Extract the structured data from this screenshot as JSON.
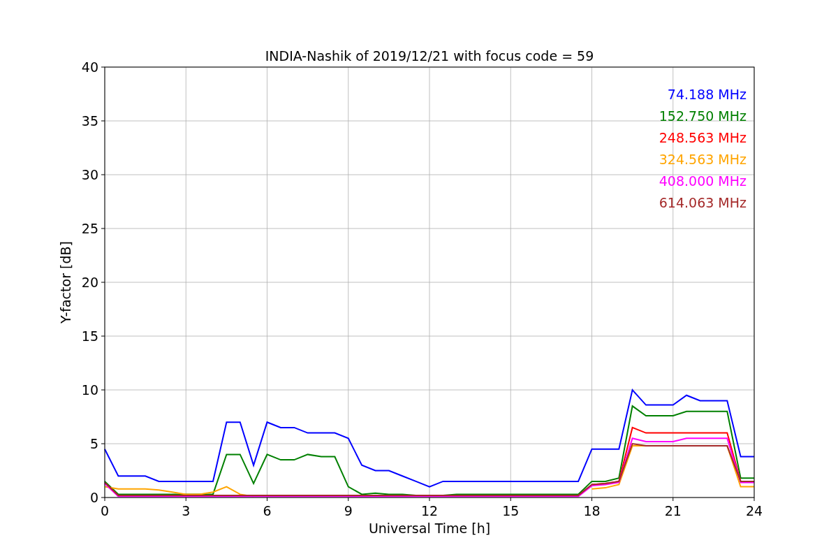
{
  "chart_data": {
    "type": "line",
    "title": "INDIA-Nashik of 2019/12/21 with focus code = 59",
    "xlabel": "Universal Time [h]",
    "ylabel": "Y-factor [dB]",
    "xlim": [
      0,
      24
    ],
    "ylim": [
      0,
      40
    ],
    "xticks": [
      0,
      3,
      6,
      9,
      12,
      15,
      18,
      21,
      24
    ],
    "yticks": [
      0,
      5,
      10,
      15,
      20,
      25,
      30,
      35,
      40
    ],
    "grid": true,
    "x": [
      0,
      0.5,
      1,
      1.5,
      2,
      2.5,
      3,
      3.5,
      4,
      4.5,
      5,
      5.5,
      6,
      6.5,
      7,
      7.5,
      8,
      8.5,
      9,
      9.5,
      10,
      10.5,
      11,
      11.5,
      12,
      12.5,
      13,
      13.5,
      14,
      14.5,
      15,
      15.5,
      16,
      16.5,
      17,
      17.5,
      18,
      18.5,
      19,
      19.5,
      20,
      20.5,
      21,
      21.5,
      22,
      22.5,
      23,
      23.5,
      24
    ],
    "series": [
      {
        "name": "74.188 MHz",
        "color": "#0000ff",
        "values": [
          4.5,
          2,
          2,
          2,
          1.5,
          1.5,
          1.5,
          1.5,
          1.5,
          7,
          7,
          3,
          7,
          6.5,
          6.5,
          6,
          6,
          6,
          5.5,
          3,
          2.5,
          2.5,
          2,
          1.5,
          1,
          1.5,
          1.5,
          1.5,
          1.5,
          1.5,
          1.5,
          1.5,
          1.5,
          1.5,
          1.5,
          1.5,
          4.5,
          4.5,
          4.5,
          10,
          8.6,
          8.6,
          8.6,
          9.5,
          9,
          9,
          9,
          3.8,
          3.8
        ]
      },
      {
        "name": "152.750 MHz",
        "color": "#008000",
        "values": [
          1.5,
          0.3,
          0.3,
          0.3,
          0.3,
          0.3,
          0.3,
          0.3,
          0.3,
          4,
          4,
          1.3,
          4,
          3.5,
          3.5,
          4,
          3.8,
          3.8,
          1,
          0.3,
          0.4,
          0.3,
          0.3,
          0.2,
          0.2,
          0.2,
          0.3,
          0.3,
          0.3,
          0.3,
          0.3,
          0.3,
          0.3,
          0.3,
          0.3,
          0.3,
          1.5,
          1.5,
          1.8,
          8.5,
          7.6,
          7.6,
          7.6,
          8,
          8,
          8,
          8,
          1.8,
          1.8
        ]
      },
      {
        "name": "248.563 MHz",
        "color": "#ff0000",
        "values": [
          null,
          null,
          null,
          null,
          null,
          null,
          null,
          null,
          null,
          null,
          null,
          null,
          null,
          null,
          null,
          null,
          null,
          null,
          null,
          null,
          null,
          null,
          null,
          null,
          null,
          null,
          null,
          null,
          null,
          null,
          null,
          null,
          null,
          null,
          null,
          null,
          1.2,
          1.3,
          1.5,
          6.5,
          6,
          6,
          6,
          6,
          6,
          6,
          6,
          1.5,
          1.5
        ]
      },
      {
        "name": "324.563 MHz",
        "color": "#ffa500",
        "values": [
          1,
          0.8,
          0.8,
          0.8,
          0.7,
          0.5,
          0.3,
          0.3,
          0.5,
          1,
          0.3,
          0.1,
          null,
          null,
          null,
          null,
          null,
          null,
          null,
          null,
          null,
          null,
          null,
          null,
          null,
          null,
          null,
          null,
          null,
          null,
          null,
          null,
          null,
          null,
          null,
          null,
          0.8,
          0.9,
          1.2,
          4.8,
          4.8,
          4.8,
          4.8,
          4.8,
          4.8,
          4.8,
          4.8,
          1,
          1
        ]
      },
      {
        "name": "408.000 MHz",
        "color": "#ff00ff",
        "values": [
          1.3,
          0.1,
          0.1,
          0.1,
          0.1,
          0.1,
          0.1,
          0.1,
          0.1,
          0.1,
          0.1,
          0.1,
          0.1,
          0.1,
          0.1,
          0.1,
          0.1,
          0.1,
          0.1,
          0.1,
          0.1,
          0.1,
          0.1,
          0.1,
          0.1,
          0.1,
          0.1,
          0.1,
          0.1,
          0.1,
          0.1,
          0.1,
          0.1,
          0.1,
          0.1,
          0.1,
          1.1,
          1.2,
          1.4,
          5.5,
          5.2,
          5.2,
          5.2,
          5.5,
          5.5,
          5.5,
          5.5,
          1.4,
          1.4
        ]
      },
      {
        "name": "614.063 MHz",
        "color": "#a52a2a",
        "values": [
          1.4,
          0.2,
          0.2,
          0.2,
          0.2,
          0.2,
          0.2,
          0.2,
          0.2,
          0.2,
          0.2,
          0.2,
          0.2,
          0.2,
          0.2,
          0.2,
          0.2,
          0.2,
          0.2,
          0.2,
          0.2,
          0.2,
          0.2,
          0.2,
          0.2,
          0.2,
          0.2,
          0.2,
          0.2,
          0.2,
          0.2,
          0.2,
          0.2,
          0.2,
          0.2,
          0.2,
          1.2,
          1.3,
          1.5,
          5,
          4.8,
          4.8,
          4.8,
          4.8,
          4.8,
          4.8,
          4.8,
          1.5,
          1.5
        ]
      }
    ]
  }
}
